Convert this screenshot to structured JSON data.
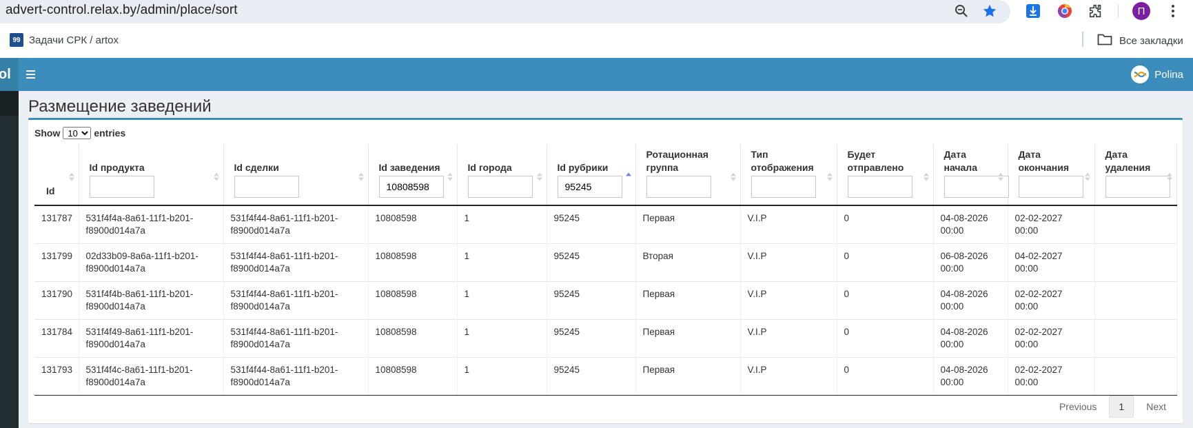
{
  "browser": {
    "url": "advert-control.relax.by/admin/place/sort",
    "bookmark_item": "Задачи СРК / artox",
    "bookmark_logo": "99",
    "all_bookmarks": "Все закладки",
    "profile_initial": "П"
  },
  "app": {
    "brand": "ol",
    "user_name": "Polina",
    "page_title": "Размещение заведений"
  },
  "table_controls": {
    "show_label": "Show",
    "entries_label": "entries",
    "page_length": "10",
    "page_length_options": [
      "10"
    ]
  },
  "columns": [
    {
      "label": "Id",
      "filter": null
    },
    {
      "label": "Id продукта",
      "filter": ""
    },
    {
      "label": "Id сделки",
      "filter": ""
    },
    {
      "label": "Id заведения",
      "filter": "10808598"
    },
    {
      "label": "Id города",
      "filter": ""
    },
    {
      "label": "Id рубрики",
      "filter": "95245"
    },
    {
      "label": "Ротационная группа",
      "filter": ""
    },
    {
      "label": "Тип отображения",
      "filter": ""
    },
    {
      "label": "Будет отправлено",
      "filter": ""
    },
    {
      "label": "Дата начала",
      "filter": ""
    },
    {
      "label": "Дата окончания",
      "filter": ""
    },
    {
      "label": "Дата удаления",
      "filter": ""
    }
  ],
  "rows": [
    [
      "131787",
      "531f4f4a-8a61-11f1-b201-f8900d014a7a",
      "531f4f44-8a61-11f1-b201-f8900d014a7a",
      "10808598",
      "1",
      "95245",
      "Первая",
      "V.I.P",
      "0",
      "04-08-2026 00:00",
      "02-02-2027 00:00",
      ""
    ],
    [
      "131799",
      "02d33b09-8a6a-11f1-b201-f8900d014a7a",
      "531f4f44-8a61-11f1-b201-f8900d014a7a",
      "10808598",
      "1",
      "95245",
      "Вторая",
      "V.I.P",
      "0",
      "06-08-2026 00:00",
      "04-02-2027 00:00",
      ""
    ],
    [
      "131790",
      "531f4f4b-8a61-11f1-b201-f8900d014a7a",
      "531f4f44-8a61-11f1-b201-f8900d014a7a",
      "10808598",
      "1",
      "95245",
      "Первая",
      "V.I.P",
      "0",
      "04-08-2026 00:00",
      "02-02-2027 00:00",
      ""
    ],
    [
      "131784",
      "531f4f49-8a61-11f1-b201-f8900d014a7a",
      "531f4f44-8a61-11f1-b201-f8900d014a7a",
      "10808598",
      "1",
      "95245",
      "Первая",
      "V.I.P",
      "0",
      "04-08-2026 00:00",
      "02-02-2027 00:00",
      ""
    ],
    [
      "131793",
      "531f4f4c-8a61-11f1-b201-f8900d014a7a",
      "531f4f44-8a61-11f1-b201-f8900d014a7a",
      "10808598",
      "1",
      "95245",
      "Первая",
      "V.I.P",
      "0",
      "04-08-2026 00:00",
      "02-02-2027 00:00",
      ""
    ]
  ],
  "sorted_column": 5,
  "pagination": {
    "previous": "Previous",
    "current": "1",
    "next": "Next"
  },
  "colors": {
    "header_blue": "#3c8dbc",
    "sidebar_dark": "#222d32",
    "content_bg": "#ecf0f5"
  },
  "icons": [
    "zoom-icon",
    "star-icon",
    "download-icon",
    "chrome-color-icon",
    "extensions-icon",
    "kebab-menu-icon",
    "folder-icon",
    "hamburger-icon",
    "sort-icon",
    "sort-asc-icon"
  ]
}
